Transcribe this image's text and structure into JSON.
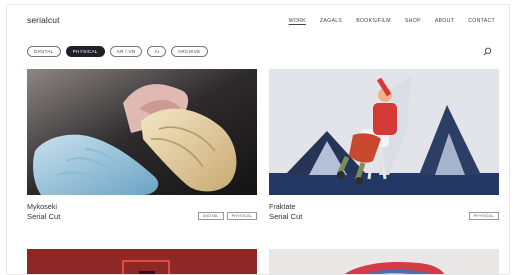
{
  "brand": "serialcut",
  "nav": [
    "WORK",
    "ZAGALS",
    "BOOKS/FILM",
    "SHOP",
    "ABOUT",
    "CONTACT"
  ],
  "filters": [
    "DIGITAL",
    "PHYSICAL",
    "AR / VR",
    "AI"
  ],
  "archive": "ARCHIVE",
  "projects": [
    {
      "title": "Mykoseki",
      "subtitle": "Serial Cut",
      "tags": [
        "DIGITAL",
        "PHYSICAL"
      ]
    },
    {
      "title": "Fraktate",
      "subtitle": "Serial Cut",
      "tags": [
        "PHYSICAL"
      ]
    }
  ],
  "colors": {
    "active_pill": "#1f2126",
    "accent_red": "#d43a35",
    "navy": "#233864"
  },
  "icons": {
    "search": "search-icon"
  }
}
